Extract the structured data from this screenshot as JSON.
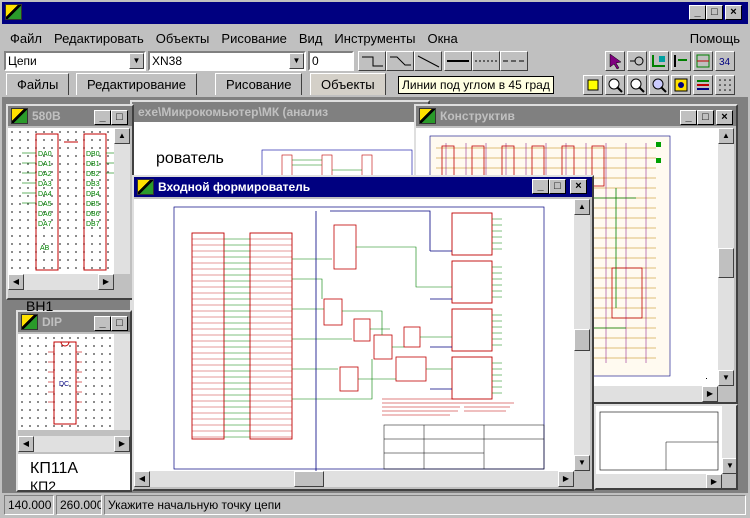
{
  "app": {
    "title": ""
  },
  "menu": {
    "items": [
      "Файл",
      "Редактировать",
      "Объекты",
      "Рисование",
      "Вид",
      "Инструменты",
      "Окна"
    ],
    "help": "Помощь"
  },
  "toolbar": {
    "layer_combo": "Цепи",
    "net_combo": "XN38",
    "width_value": "0",
    "tooltip": "Линии под углом в 45 град"
  },
  "tabs": [
    "Файлы",
    "Редактирование",
    "Рисование",
    "Объекты"
  ],
  "windows": {
    "w580": {
      "title": "580В"
    },
    "behind": {
      "title": "exe\\Микрокомьютер\\МК (анализ",
      "text": "рователь"
    },
    "konstruktiv": {
      "title": "Конструктив"
    },
    "dip": {
      "title": "DIP",
      "bottom_label_1": "КП11А",
      "bottom_label_2": "КП2",
      "top_label": "ВН1"
    },
    "vhodnoy": {
      "title": "Входной формирователь"
    }
  },
  "status": {
    "x": "140.000",
    "y": "260.000",
    "message": "Укажите начальную точку цепи"
  },
  "colors": {
    "titlebar_active": "#000080",
    "titlebar_inactive": "#808080",
    "schematic_red": "#c00000",
    "schematic_green": "#008000",
    "schematic_blue": "#0000a0"
  }
}
